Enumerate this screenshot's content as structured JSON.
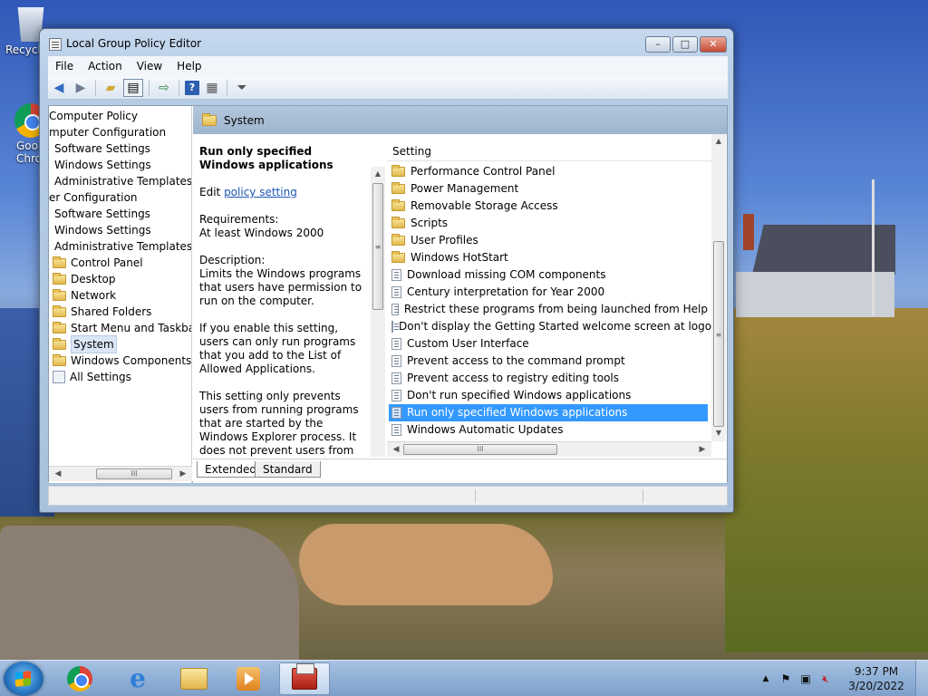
{
  "window": {
    "title": "Local Group Policy Editor",
    "controls": {
      "minimize": "–",
      "maximize": "□",
      "close": "✕"
    }
  },
  "desktop": {
    "icons": [
      {
        "label": "Recycl"
      },
      {
        "label": "Goo\nChro"
      }
    ]
  },
  "menu": [
    "File",
    "Action",
    "View",
    "Help"
  ],
  "tree": {
    "items": [
      {
        "label": "Computer Policy",
        "icon": "none"
      },
      {
        "label": "mputer Configuration",
        "icon": "none"
      },
      {
        "label": "Software Settings",
        "icon": "none"
      },
      {
        "label": "Windows Settings",
        "icon": "none"
      },
      {
        "label": "Administrative Templates",
        "icon": "none"
      },
      {
        "label": "er Configuration",
        "icon": "none"
      },
      {
        "label": "Software Settings",
        "icon": "none"
      },
      {
        "label": "Windows Settings",
        "icon": "none"
      },
      {
        "label": "Administrative Templates",
        "icon": "none"
      },
      {
        "label": "Control Panel",
        "icon": "folder"
      },
      {
        "label": "Desktop",
        "icon": "folder"
      },
      {
        "label": "Network",
        "icon": "folder"
      },
      {
        "label": "Shared Folders",
        "icon": "folder"
      },
      {
        "label": "Start Menu and Taskbar",
        "icon": "folder"
      },
      {
        "label": "System",
        "icon": "folder",
        "selected": true
      },
      {
        "label": "Windows Components",
        "icon": "folder"
      },
      {
        "label": "All Settings",
        "icon": "all-settings"
      }
    ]
  },
  "pane": {
    "title": "System"
  },
  "description": {
    "title": "Run only specified Windows applications",
    "edit_prefix": "Edit ",
    "edit_link": "policy setting ",
    "requirements_label": "Requirements:",
    "requirements_value": "At least Windows 2000",
    "description_label": "Description:",
    "p1": "Limits the Windows programs that users have permission to run on the computer.",
    "p2": "If you enable this setting, users can only run programs that you add to the List of Allowed Applications.",
    "p3": "This setting only prevents users from running programs that are started by the Windows Explorer process. It does not prevent users from running programs such as"
  },
  "list": {
    "column_header": "Setting",
    "rows": [
      {
        "label": "Performance Control Panel",
        "icon": "folder"
      },
      {
        "label": "Power Management",
        "icon": "folder"
      },
      {
        "label": "Removable Storage Access",
        "icon": "folder"
      },
      {
        "label": "Scripts",
        "icon": "folder"
      },
      {
        "label": "User Profiles",
        "icon": "folder"
      },
      {
        "label": "Windows HotStart",
        "icon": "folder"
      },
      {
        "label": "Download missing COM components",
        "icon": "setting"
      },
      {
        "label": "Century interpretation for Year 2000",
        "icon": "setting"
      },
      {
        "label": "Restrict these programs from being launched from Help",
        "icon": "setting"
      },
      {
        "label": "Don't display the Getting Started welcome screen at logon",
        "icon": "setting"
      },
      {
        "label": "Custom User Interface",
        "icon": "setting"
      },
      {
        "label": "Prevent access to the command prompt",
        "icon": "setting"
      },
      {
        "label": "Prevent access to registry editing tools",
        "icon": "setting"
      },
      {
        "label": "Don't run specified Windows applications",
        "icon": "setting"
      },
      {
        "label": "Run only specified Windows applications",
        "icon": "setting",
        "selected": true
      },
      {
        "label": "Windows Automatic Updates",
        "icon": "setting"
      }
    ]
  },
  "tabs": [
    {
      "label": "Extended",
      "active": true
    },
    {
      "label": "Standard",
      "active": false
    }
  ],
  "scroll": {
    "thumb_grip": "III",
    "vgrip": "≡",
    "left": "◀",
    "right": "▶",
    "up": "▲",
    "down": "▼"
  },
  "taskbar": {
    "apps": [
      "chrome-icon",
      "internet-explorer-icon",
      "windows-explorer-icon",
      "media-player-icon",
      "group-policy-editor-icon"
    ],
    "ie_glyph": "e",
    "clock_time": "9:37 PM",
    "clock_date": "3/20/2022",
    "tray_up": "▲"
  }
}
